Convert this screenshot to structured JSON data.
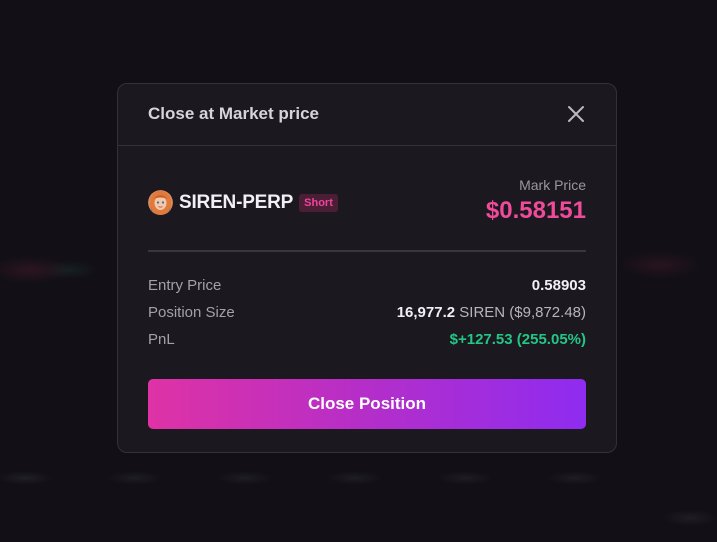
{
  "modal": {
    "title": "Close at Market price",
    "close_icon": "close-icon"
  },
  "market": {
    "avatar_icon": "siren-token-avatar",
    "name": "SIREN-PERP",
    "side": "Short",
    "mark_price_label": "Mark Price",
    "mark_price_value": "$0.58151"
  },
  "details": {
    "entry_price_label": "Entry Price",
    "entry_price_value": "0.58903",
    "position_size_label": "Position Size",
    "position_size_amount": "16,977.2",
    "position_size_unit": "SIREN ($9,872.48)",
    "pnl_label": "PnL",
    "pnl_value": "$+127.53 (255.05%)"
  },
  "actions": {
    "close_position_label": "Close Position"
  },
  "colors": {
    "accent_pink": "#f04a9b",
    "pnl_green": "#22c784",
    "button_gradient_start": "#df32a5",
    "button_gradient_end": "#8f2cf0"
  }
}
